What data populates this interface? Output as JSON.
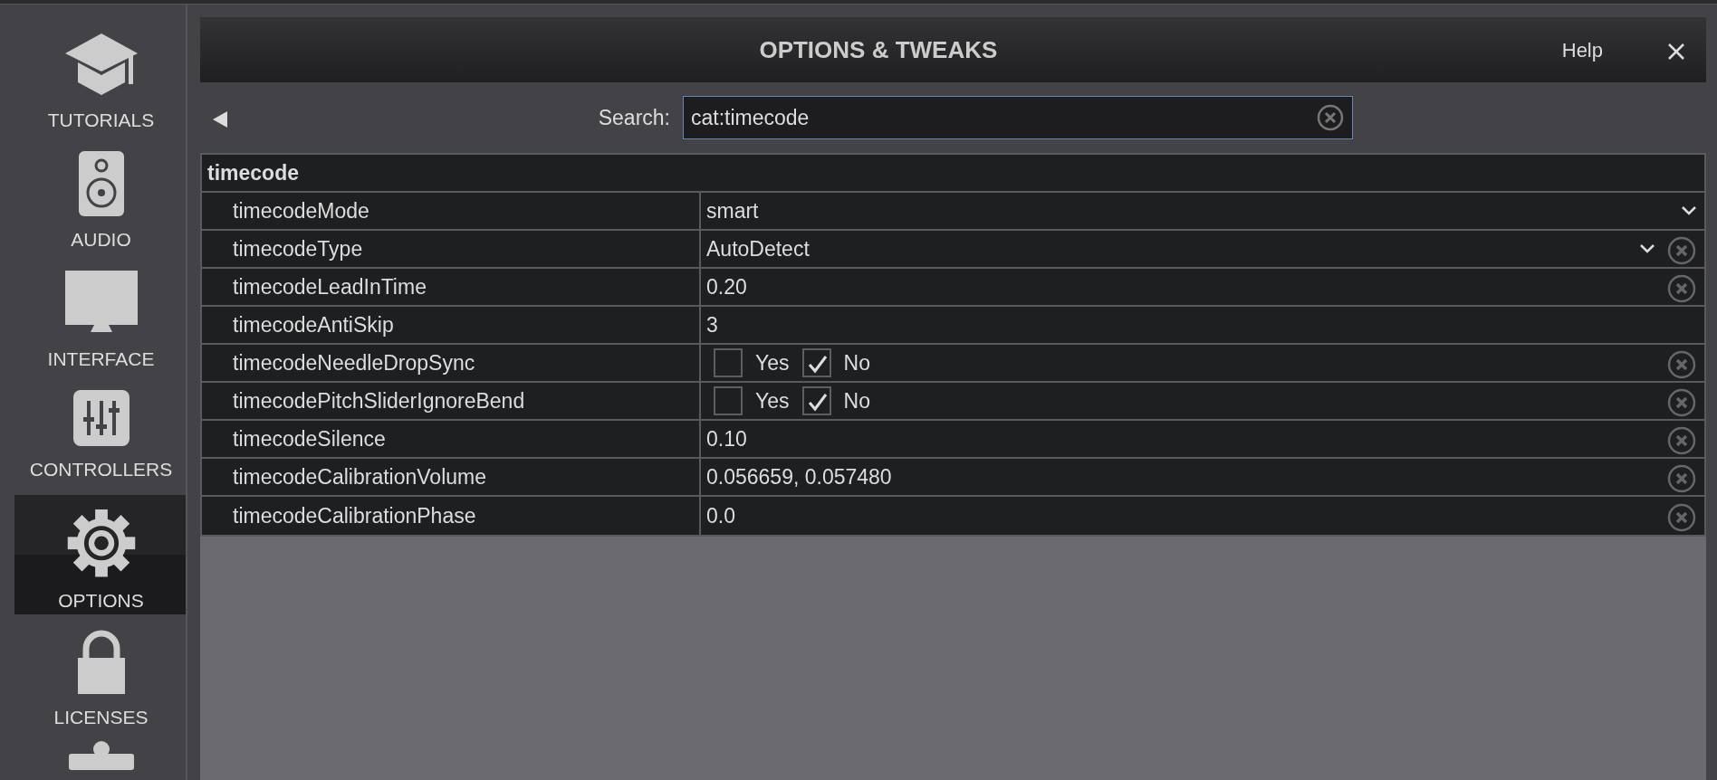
{
  "sidebar": {
    "items": [
      {
        "label": "TUTORIALS",
        "selected": false
      },
      {
        "label": "AUDIO",
        "selected": false
      },
      {
        "label": "INTERFACE",
        "selected": false
      },
      {
        "label": "CONTROLLERS",
        "selected": false
      },
      {
        "label": "OPTIONS",
        "selected": true
      },
      {
        "label": "LICENSES",
        "selected": false
      }
    ]
  },
  "dialog": {
    "title": "OPTIONS & TWEAKS",
    "help": "Help"
  },
  "search": {
    "label": "Search:",
    "value": "cat:timecode"
  },
  "table": {
    "group": "timecode",
    "rows": [
      {
        "name": "timecodeMode",
        "kind": "select",
        "value": "smart",
        "reset": false
      },
      {
        "name": "timecodeType",
        "kind": "select",
        "value": "AutoDetect",
        "reset": true
      },
      {
        "name": "timecodeLeadInTime",
        "kind": "text",
        "value": "0.20",
        "reset": true
      },
      {
        "name": "timecodeAntiSkip",
        "kind": "text",
        "value": "3",
        "reset": false
      },
      {
        "name": "timecodeNeedleDropSync",
        "kind": "choice",
        "options": [
          {
            "label": "Yes",
            "checked": false
          },
          {
            "label": "No",
            "checked": true
          }
        ],
        "reset": true
      },
      {
        "name": "timecodePitchSliderIgnoreBend",
        "kind": "choice",
        "options": [
          {
            "label": "Yes",
            "checked": false
          },
          {
            "label": "No",
            "checked": true
          }
        ],
        "reset": true
      },
      {
        "name": "timecodeSilence",
        "kind": "text",
        "value": "0.10",
        "reset": true
      },
      {
        "name": "timecodeCalibrationVolume",
        "kind": "text",
        "value": "0.056659, 0.057480",
        "reset": true
      },
      {
        "name": "timecodeCalibrationPhase",
        "kind": "text",
        "value": "0.0",
        "reset": true
      }
    ]
  }
}
